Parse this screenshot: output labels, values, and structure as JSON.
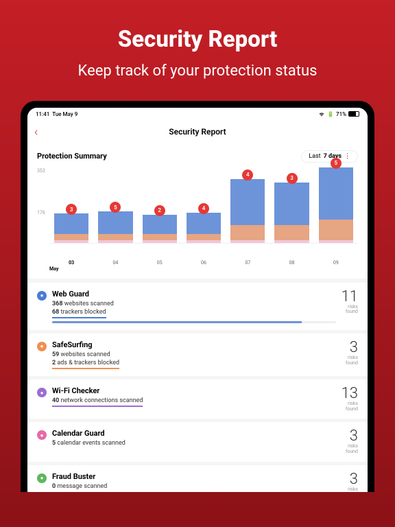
{
  "hero": {
    "title": "Security Report",
    "subtitle": "Keep track of your protection status"
  },
  "statusbar": {
    "time": "11:41",
    "date": "Tue May 9",
    "battery": "71%"
  },
  "nav": {
    "title": "Security Report"
  },
  "summary": {
    "title": "Protection Summary",
    "range_prefix": "Last",
    "range_value": "7 days"
  },
  "chart_data": {
    "type": "bar",
    "ylim": [
      0,
      353
    ],
    "ytick_top": "353",
    "ytick_mid": "176",
    "categories": [
      "03",
      "04",
      "05",
      "06",
      "07",
      "08",
      "09"
    ],
    "month": "May",
    "badges": [
      3,
      5,
      2,
      4,
      4,
      3,
      5
    ],
    "series": [
      {
        "name": "blue",
        "values": [
          95,
          105,
          90,
          100,
          215,
          200,
          245
        ]
      },
      {
        "name": "orange",
        "values": [
          28,
          28,
          28,
          28,
          70,
          70,
          95
        ]
      },
      {
        "name": "pink",
        "values": [
          4,
          4,
          4,
          4,
          4,
          4,
          4
        ]
      }
    ]
  },
  "features": [
    {
      "id": "web-guard",
      "name": "Web Guard",
      "icon": "ic-blue",
      "stat1_num": "368",
      "stat1_txt": " websites scanned",
      "stat2_num": "68",
      "stat2_txt": " trackers blocked",
      "underline": "underline-b",
      "risks": "11",
      "progress": true
    },
    {
      "id": "safesurfing",
      "name": "SafeSurfing",
      "icon": "ic-orange",
      "stat1_num": "59",
      "stat1_txt": " websites scanned",
      "stat2_num": "2",
      "stat2_txt": " ads & trackers blocked",
      "underline": "underline-o",
      "risks": "3"
    },
    {
      "id": "wifi-checker",
      "name": "Wi-Fi Checker",
      "icon": "ic-purple",
      "stat1_num": "40",
      "stat1_txt": " network connections scanned",
      "underline": "underline-p",
      "risks": "13"
    },
    {
      "id": "calendar-guard",
      "name": "Calendar Guard",
      "icon": "ic-pink",
      "stat1_num": "5",
      "stat1_txt": " calendar events scanned",
      "risks": "3"
    },
    {
      "id": "fraud-buster",
      "name": "Fraud Buster",
      "icon": "ic-green",
      "stat1_num": "0",
      "stat1_txt": " message scanned",
      "risks": "3"
    }
  ],
  "risks_label1": "risks",
  "risks_label2": "found"
}
